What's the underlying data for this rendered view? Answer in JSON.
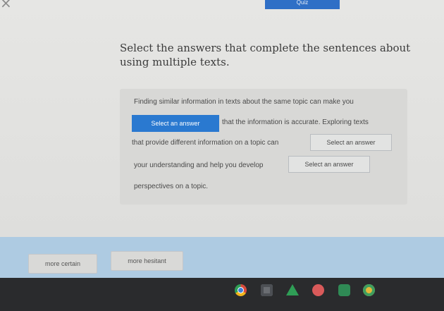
{
  "window": {
    "close_glyph": "×",
    "tab_label": "Quiz"
  },
  "question": "Select the answers that complete the sentences about using multiple texts.",
  "passage": {
    "line1": "Finding similar information in texts about the same topic can make you",
    "dropdown1": "Select an answer",
    "line2": "that the information is accurate. Exploring texts",
    "line3": "that provide different information on a topic can",
    "dropdown2": "Select an answer",
    "line4": "your understanding and help you develop",
    "dropdown3": "Select an answer",
    "line5": "perspectives on a topic."
  },
  "choices": [
    "more certain",
    "more hesitant"
  ],
  "shelf": {
    "icons": [
      "chrome-icon",
      "files-icon",
      "drive-icon",
      "play-store-icon",
      "classroom-icon",
      "photos-icon"
    ],
    "colors": {
      "chrome": "#f2b51c",
      "files": "#6a6d72",
      "drive": "#2f9e56",
      "play": "#d95a5a",
      "classroom": "#2f8a55",
      "photos": "#e3b83a"
    }
  },
  "colors": {
    "accent": "#2a79d0",
    "choices_bar": "#aecbe2",
    "shelf": "#2a2b2d"
  }
}
